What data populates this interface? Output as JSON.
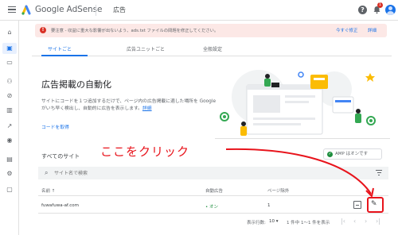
{
  "app": {
    "brand": "Google AdSense",
    "page_title": "広告",
    "notifications": "1"
  },
  "alert": {
    "message": "要注意 - 収益に重大な影響が出ないよう、ads.txt ファイルの問題を修正してください。",
    "fix_now": "今すぐ修正",
    "details": "詳細"
  },
  "tabs": [
    {
      "label": "サイトごと"
    },
    {
      "label": "広告ユニットごと"
    },
    {
      "label": "全般設定"
    }
  ],
  "hero": {
    "title": "広告掲載の自動化",
    "desc": "サイトにコードを１つ追加するだけで、ページ内の広告掲載に適した場所を Google がいち早く検出し、自動的に広告を表示します。",
    "desc_link": "詳細",
    "get_code": "コードを取得"
  },
  "sites": {
    "heading": "すべてのサイト",
    "annotation": "ここをクリック",
    "amp_label": "AMP はオンです",
    "search_placeholder": "サイト名で検索",
    "columns": {
      "name": "名前 ↑",
      "auto_ads": "自動広告",
      "page_exclusions": "ページ除外"
    },
    "rows": [
      {
        "name": "fuwafuwa-af.com",
        "auto_ads": "• オン",
        "page_exclusions": "1"
      }
    ]
  },
  "pagination": {
    "rows_label": "表示行数:",
    "rows_value": "10 ▾",
    "range": "1 件中 1〜1 件を表示"
  },
  "colors": {
    "accent": "#1a73e8",
    "alert_bg": "#fce8e6",
    "annotation": "#e8141c",
    "on_green": "#1e8e3e"
  },
  "icons": [
    "menu-icon",
    "adsense-logo",
    "help-icon",
    "bell-icon",
    "avatar",
    "home-icon",
    "ads-icon",
    "page-icon",
    "people-icon",
    "block-icon",
    "chart-icon",
    "trend-icon",
    "shield-icon",
    "payments-icon",
    "gear-icon",
    "feedback-icon",
    "search-icon",
    "filter-icon",
    "edit-icon"
  ]
}
